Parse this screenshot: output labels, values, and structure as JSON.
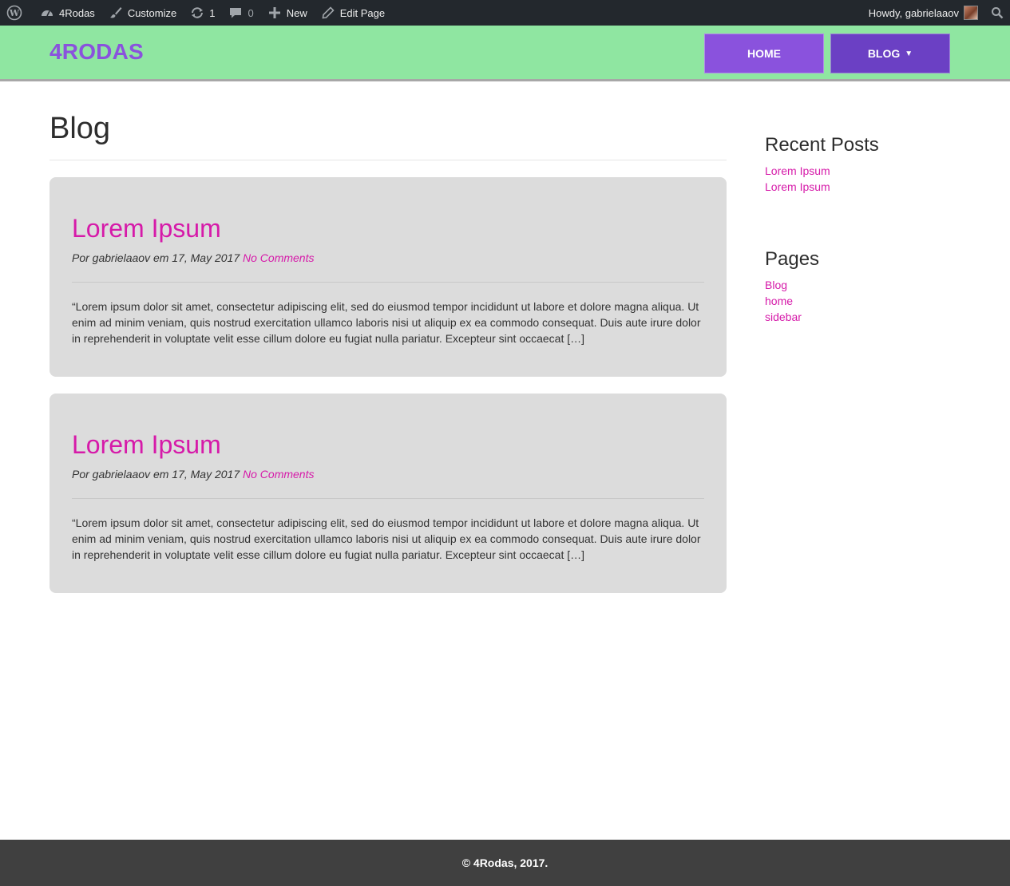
{
  "admin_bar": {
    "site_name": "4Rodas",
    "customize": "Customize",
    "updates_count": "1",
    "comments_count": "0",
    "new_label": "New",
    "edit_page": "Edit Page",
    "howdy": "Howdy, gabrielaaov"
  },
  "header": {
    "brand": "4RODAS",
    "nav": {
      "home": "HOME",
      "blog": "BLOG"
    }
  },
  "page": {
    "title": "Blog"
  },
  "posts": [
    {
      "title": "Lorem Ipsum",
      "meta": "Por gabrielaaov em 17, May 2017",
      "comments": "No Comments",
      "excerpt": "“Lorem ipsum dolor sit amet, consectetur adipiscing elit, sed do eiusmod tempor incididunt ut labore et dolore magna aliqua. Ut enim ad minim veniam, quis nostrud exercitation ullamco laboris nisi ut aliquip ex ea commodo consequat. Duis aute irure dolor in reprehenderit in voluptate velit esse cillum dolore eu fugiat nulla pariatur. Excepteur sint occaecat […]"
    },
    {
      "title": "Lorem Ipsum",
      "meta": "Por gabrielaaov em 17, May 2017",
      "comments": "No Comments",
      "excerpt": "“Lorem ipsum dolor sit amet, consectetur adipiscing elit, sed do eiusmod tempor incididunt ut labore et dolore magna aliqua. Ut enim ad minim veniam, quis nostrud exercitation ullamco laboris nisi ut aliquip ex ea commodo consequat. Duis aute irure dolor in reprehenderit in voluptate velit esse cillum dolore eu fugiat nulla pariatur. Excepteur sint occaecat […]"
    }
  ],
  "sidebar": {
    "recent_posts": {
      "title": "Recent Posts",
      "items": [
        "Lorem Ipsum",
        "Lorem Ipsum"
      ]
    },
    "pages": {
      "title": "Pages",
      "items": [
        "Blog",
        "home",
        "sidebar"
      ]
    }
  },
  "footer": {
    "text": "© 4Rodas, 2017."
  },
  "colors": {
    "admin_bar": "#23282d",
    "header_bg": "#8fe6a1",
    "brand": "#8a52dd",
    "nav_blog": "#6b40c4",
    "link": "#d61aa9",
    "post_bg": "#dcdcdc",
    "footer_bg": "#404040"
  }
}
